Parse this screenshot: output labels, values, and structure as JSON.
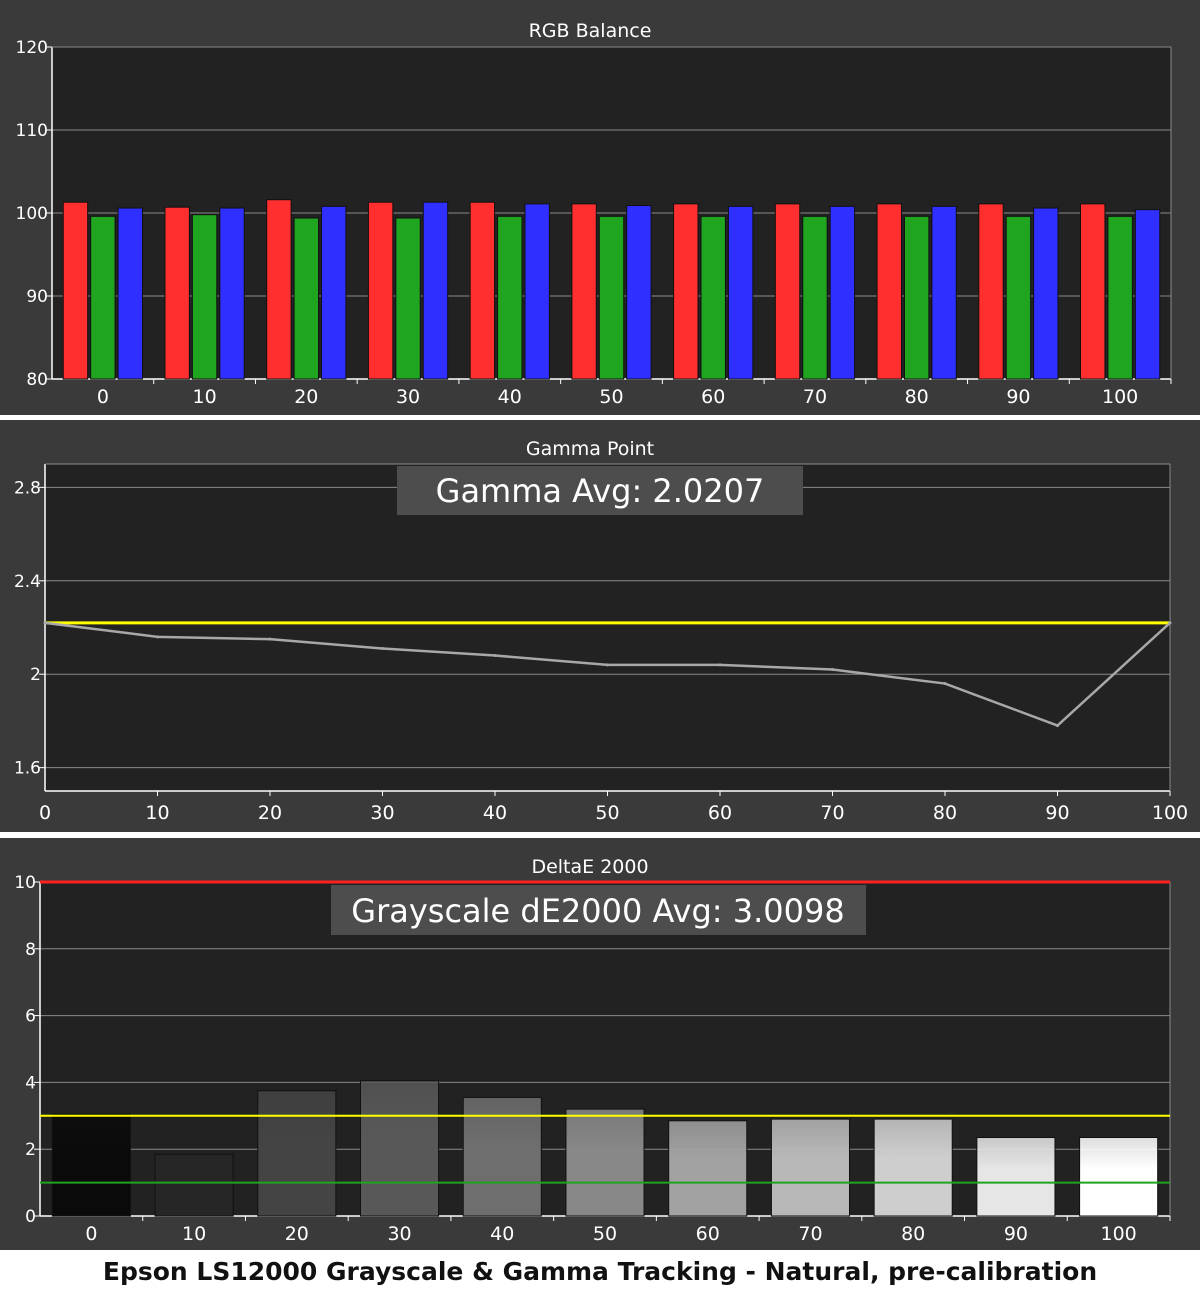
{
  "caption": "Epson LS12000 Grayscale & Gamma Tracking - Natural, pre-calibration",
  "colors": {
    "panel_bg": "#3a3a3a",
    "plot_bg": "#222222",
    "grid": "#8a8a8a",
    "red": "#ff2f2f",
    "green": "#1fa51f",
    "blue": "#2f2fff",
    "target_yellow": "#ffff00",
    "gamma_line": "#a8a8a8",
    "delta_limit_red": "#ff2020",
    "delta_green_line": "#1fa51f",
    "label_box_bg": "#4d4d4d"
  },
  "chart_data": [
    {
      "id": "rgb",
      "type": "bar",
      "title": "RGB Balance",
      "categories": [
        "0",
        "10",
        "20",
        "30",
        "40",
        "50",
        "60",
        "70",
        "80",
        "90",
        "100"
      ],
      "series": [
        {
          "color": "red",
          "values": [
            101.3,
            100.7,
            101.6,
            101.3,
            101.3,
            101.1,
            101.1,
            101.1,
            101.1,
            101.1,
            101.1
          ]
        },
        {
          "color": "green",
          "values": [
            99.6,
            99.8,
            99.4,
            99.4,
            99.6,
            99.6,
            99.6,
            99.6,
            99.6,
            99.6,
            99.6
          ]
        },
        {
          "color": "blue",
          "values": [
            100.6,
            100.6,
            100.8,
            101.3,
            101.1,
            100.9,
            100.8,
            100.8,
            100.8,
            100.6,
            100.4
          ]
        }
      ],
      "ylim": [
        80,
        120
      ],
      "yticks": [
        "80",
        "90",
        "100",
        "110",
        "120"
      ],
      "grid": true
    },
    {
      "id": "gamma",
      "type": "line",
      "title": "Gamma Point",
      "annotation": "Gamma Avg: 2.0207",
      "x": [
        0,
        10,
        20,
        30,
        40,
        50,
        60,
        70,
        80,
        90,
        100
      ],
      "xticks": [
        "0",
        "10",
        "20",
        "30",
        "40",
        "50",
        "60",
        "70",
        "80",
        "90",
        "100"
      ],
      "series": [
        {
          "values": [
            2.22,
            2.16,
            2.15,
            2.11,
            2.08,
            2.04,
            2.04,
            2.02,
            1.96,
            1.78,
            2.22
          ]
        }
      ],
      "target": 2.22,
      "ylim": [
        1.5,
        2.9
      ],
      "yticks": [
        "1.6",
        "2",
        "2.4",
        "2.8"
      ],
      "grid": true
    },
    {
      "id": "delta",
      "type": "bar",
      "title": "DeltaE 2000",
      "annotation": "Grayscale dE2000 Avg: 3.0098",
      "categories": [
        "0",
        "10",
        "20",
        "30",
        "40",
        "50",
        "60",
        "70",
        "80",
        "90",
        "100"
      ],
      "values": [
        3.05,
        1.85,
        3.75,
        4.05,
        3.55,
        3.2,
        2.85,
        2.9,
        2.9,
        2.35,
        2.35
      ],
      "bar_shades": [
        "#0a0a0a",
        "#262626",
        "#444444",
        "#585858",
        "#6e6e6e",
        "#888888",
        "#a2a2a2",
        "#b8b8b8",
        "#cecece",
        "#e6e6e6",
        "#ffffff"
      ],
      "avg_line": 3.0,
      "green_line": 1.0,
      "limit_line": 10,
      "ylim": [
        0,
        10
      ],
      "yticks": [
        "0",
        "2",
        "4",
        "6",
        "8",
        "10"
      ],
      "grid": true
    }
  ]
}
